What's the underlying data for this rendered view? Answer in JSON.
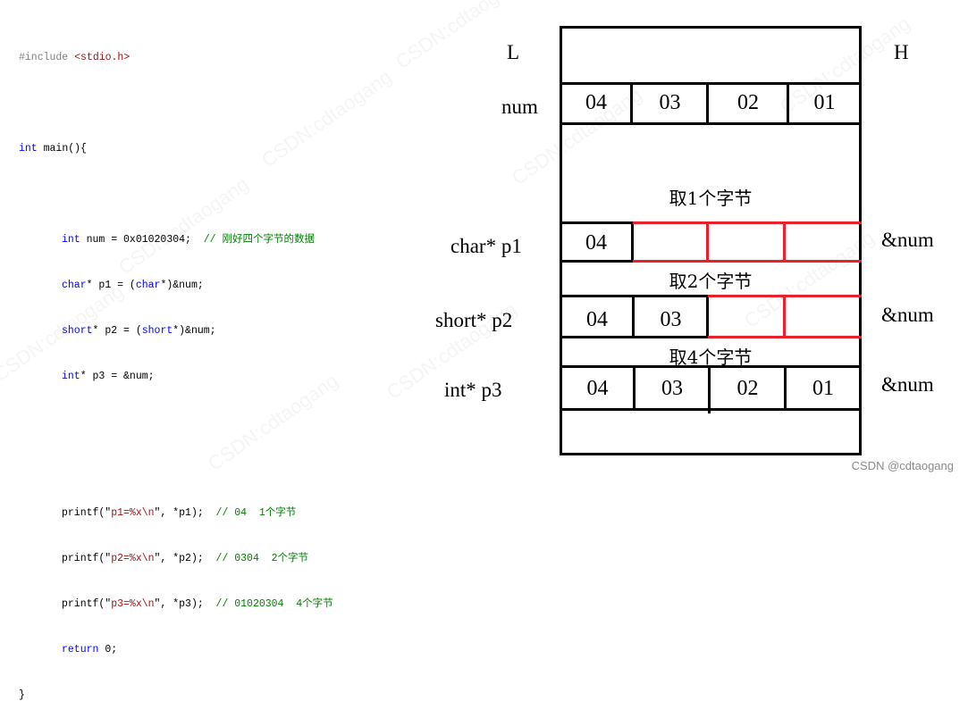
{
  "code": {
    "include": "#include",
    "include_file": "<stdio.h>",
    "main_kw": "int",
    "main_sig": " main(){",
    "line_num": {
      "kw": "int",
      "rest": " num = 0x01020304;  ",
      "comment": "// 刚好四个字节的数据"
    },
    "line_p1": {
      "kw1": "char",
      "mid": "* p1 = (",
      "kw2": "char",
      "rest": "*)&num;"
    },
    "line_p2": {
      "kw1": "short",
      "mid": "* p2 = (",
      "kw2": "short",
      "rest": "*)&num;"
    },
    "line_p3": {
      "kw": "int",
      "rest": "* p3 = &num;"
    },
    "printf1": {
      "pre": "printf(\"",
      "fmt": "p1=%x\\n",
      "post": "\", *p1);  ",
      "comment": "// 04  1个字节"
    },
    "printf2": {
      "pre": "printf(\"",
      "fmt": "p2=%x\\n",
      "post": "\", *p2);  ",
      "comment": "// 0304  2个字节"
    },
    "printf3": {
      "pre": "printf(\"",
      "fmt": "p3=%x\\n",
      "post": "\", *p3);  ",
      "comment": "// 01020304  4个字节"
    },
    "return_kw": "return",
    "return_rest": " 0;",
    "close_brace": "}"
  },
  "diagram": {
    "low_label": "L",
    "high_label": "H",
    "num_label": "num",
    "num_bytes": [
      "04",
      "03",
      "02",
      "01"
    ],
    "take1_label": "取1个字节",
    "p1_label": "char* p1",
    "p1_bytes": [
      "04"
    ],
    "p1_addr": "&num",
    "take2_label": "取2个字节",
    "p2_label": "short* p2",
    "p2_bytes": [
      "04",
      "03"
    ],
    "p2_addr": "&num",
    "take4_label": "取4个字节",
    "p3_label": "int* p3",
    "p3_bytes": [
      "04",
      "03",
      "02",
      "01"
    ],
    "p3_addr": "&num",
    "highlight_color": "#e8212b"
  },
  "watermark": {
    "credit": "CSDN @cdtaogang",
    "background_text": "CSDN:cdtaogang"
  }
}
